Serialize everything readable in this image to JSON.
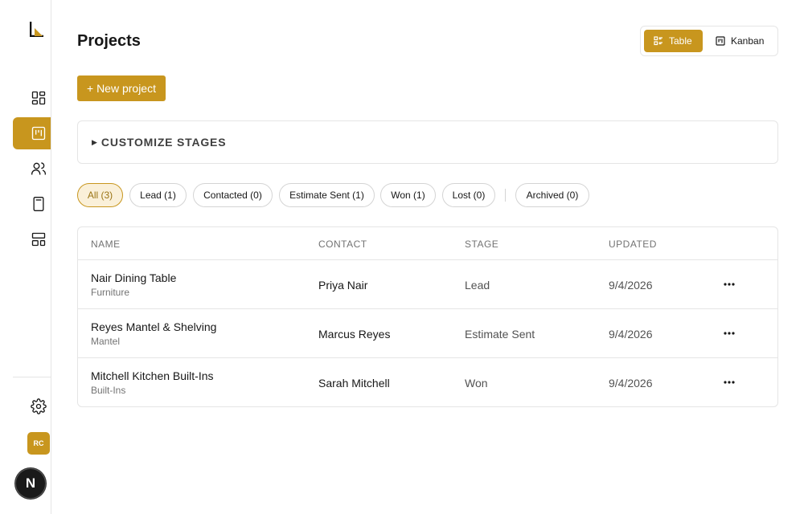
{
  "sidebar": {
    "logo_icon": "brand-logo-icon",
    "items": [
      {
        "icon": "dashboard-icon",
        "active": false
      },
      {
        "icon": "kanban-board-icon",
        "active": true
      },
      {
        "icon": "users-icon",
        "active": false
      },
      {
        "icon": "calculator-icon",
        "active": false
      },
      {
        "icon": "layout-templates-icon",
        "active": false
      }
    ],
    "settings_icon": "gear-icon",
    "avatar_initials": "RC",
    "dev_badge": "N"
  },
  "header": {
    "title": "Projects",
    "view_toggle": {
      "table_label": "Table",
      "kanban_label": "Kanban",
      "selected": "Table"
    }
  },
  "actions": {
    "new_project_label": "+ New project"
  },
  "customize": {
    "label": "CUSTOMIZE STAGES"
  },
  "filters": [
    {
      "label": "All (3)",
      "active": true
    },
    {
      "label": "Lead (1)",
      "active": false
    },
    {
      "label": "Contacted (0)",
      "active": false
    },
    {
      "label": "Estimate Sent (1)",
      "active": false
    },
    {
      "label": "Won (1)",
      "active": false
    },
    {
      "label": "Lost (0)",
      "active": false
    },
    {
      "label": "Archived (0)",
      "active": false
    }
  ],
  "table": {
    "columns": [
      "NAME",
      "CONTACT",
      "STAGE",
      "UPDATED"
    ],
    "rows": [
      {
        "name": "Nair Dining Table",
        "category": "Furniture",
        "contact": "Priya Nair",
        "stage": "Lead",
        "updated": "9/4/2026"
      },
      {
        "name": "Reyes Mantel & Shelving",
        "category": "Mantel",
        "contact": "Marcus Reyes",
        "stage": "Estimate Sent",
        "updated": "9/4/2026"
      },
      {
        "name": "Mitchell Kitchen Built-Ins",
        "category": "Built-Ins",
        "contact": "Sarah Mitchell",
        "stage": "Won",
        "updated": "9/4/2026"
      }
    ]
  },
  "colors": {
    "accent": "#c8961e",
    "accent_soft": "#faf0d9",
    "border": "#e5e5e5",
    "muted_text": "#737373"
  }
}
